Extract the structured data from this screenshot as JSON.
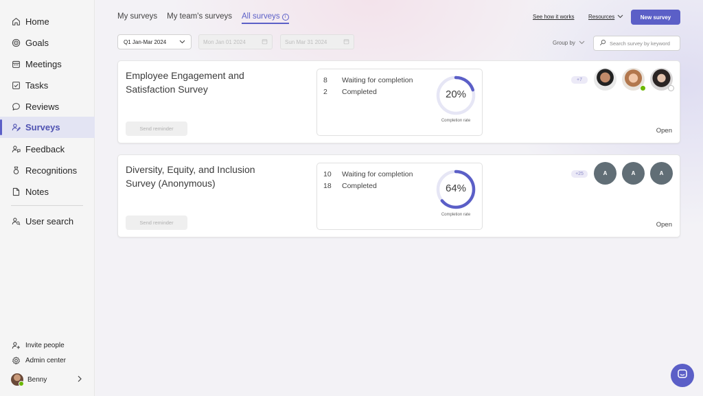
{
  "sidebar": {
    "nav": [
      {
        "label": "Home",
        "icon": "home-icon"
      },
      {
        "label": "Goals",
        "icon": "target-icon"
      },
      {
        "label": "Meetings",
        "icon": "calendar-icon"
      },
      {
        "label": "Tasks",
        "icon": "checkbox-icon"
      },
      {
        "label": "Reviews",
        "icon": "chat-bubble-icon"
      },
      {
        "label": "Surveys",
        "icon": "people-survey-icon",
        "active": true
      },
      {
        "label": "Feedback",
        "icon": "feedback-icon"
      },
      {
        "label": "Recognitions",
        "icon": "ribbon-icon"
      },
      {
        "label": "Notes",
        "icon": "note-icon"
      },
      {
        "label": "User search",
        "icon": "user-search-icon"
      }
    ],
    "footer": {
      "invite": "Invite people",
      "admin": "Admin center",
      "user": "Benny"
    }
  },
  "tabs": [
    {
      "label": "My surveys"
    },
    {
      "label": "My team's surveys"
    },
    {
      "label": "All surveys",
      "active": true
    }
  ],
  "header": {
    "see_how": "See how it works",
    "resources": "Resources",
    "new_survey": "New survey"
  },
  "filters": {
    "period": "Q1 Jan-Mar 2024",
    "start_date": "Mon Jan 01 2024",
    "end_date": "Sun Mar 31 2024",
    "group_by": "Group by",
    "search_placeholder": "Search survey by keyword"
  },
  "surveys": [
    {
      "title": "Employee Engagement and Satisfaction Survey",
      "waiting_count": "8",
      "waiting_label": "Waiting for completion",
      "completed_count": "2",
      "completed_label": "Completed",
      "rate": 20,
      "rate_text": "20%",
      "rate_label": "Completion rate",
      "reminder": "Send reminder",
      "more": "+7",
      "open": "Open"
    },
    {
      "title": "Diversity, Equity, and Inclusion Survey (Anonymous)",
      "waiting_count": "10",
      "waiting_label": "Waiting for completion",
      "completed_count": "18",
      "completed_label": "Completed",
      "rate": 64,
      "rate_text": "64%",
      "rate_label": "Completion rate",
      "reminder": "Send reminder",
      "more": "+25",
      "avatar_initial": "A",
      "open": "Open"
    }
  ],
  "colors": {
    "accent": "#5b5fc7",
    "ring_track": "#e6e6f5",
    "presence_available": "#6bb700"
  }
}
